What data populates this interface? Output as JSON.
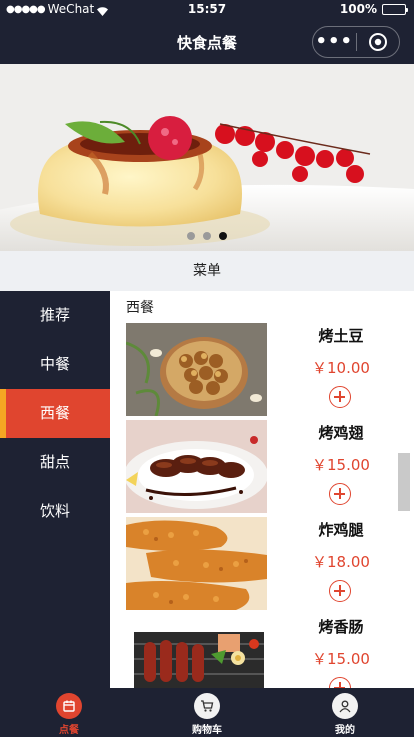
{
  "status_bar": {
    "signal": "●●●●●",
    "carrier": "WeChat",
    "time": "15:57",
    "battery": "100%"
  },
  "nav": {
    "title": "快食点餐",
    "more_label": "•••"
  },
  "banner": {
    "slide_count": 3,
    "active_slide": 3
  },
  "menu_title": "菜单",
  "categories": [
    {
      "label": "推荐",
      "active": false
    },
    {
      "label": "中餐",
      "active": false
    },
    {
      "label": "西餐",
      "active": true
    },
    {
      "label": "甜点",
      "active": false
    },
    {
      "label": "饮料",
      "active": false
    }
  ],
  "section_title": "西餐",
  "items": [
    {
      "name": "烤土豆",
      "price": "￥10.00"
    },
    {
      "name": "烤鸡翅",
      "price": "￥15.00"
    },
    {
      "name": "炸鸡腿",
      "price": "￥18.00"
    },
    {
      "name": "烤香肠",
      "price": "￥15.00"
    }
  ],
  "tabs": [
    {
      "label": "点餐",
      "active": true,
      "icon": "menu-icon"
    },
    {
      "label": "购物车",
      "active": false,
      "icon": "cart-icon"
    },
    {
      "label": "我的",
      "active": false,
      "icon": "user-icon"
    }
  ],
  "colors": {
    "dark": "#1e2233",
    "accent": "#e0452f",
    "highlight": "#f5a623"
  }
}
